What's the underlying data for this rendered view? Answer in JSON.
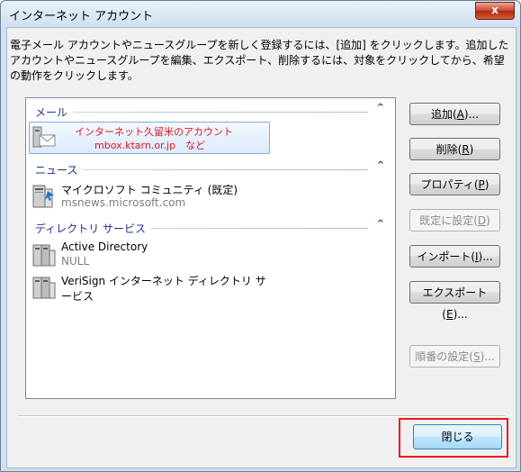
{
  "window": {
    "title": "インターネット アカウント",
    "close_glyph": "x"
  },
  "description": "電子メール アカウントやニュースグループを新しく登録するには、[追加] をクリックします。追加したアカウントやニュースグループを編集、エクスポート、削除するには、対象をクリックしてから、希望の動作をクリックします。",
  "groups": {
    "mail": {
      "label": "メール",
      "chevron": "^",
      "item_line1": "インターネット久留米のアカウント",
      "item_line2": "mbox.ktarn.or.jp　など"
    },
    "news": {
      "label": "ニュース",
      "chevron": "^",
      "item_name": "マイクロソフト コミュニティ (既定)",
      "item_sub": "msnews.microsoft.com"
    },
    "directory": {
      "label": "ディレクトリ サービス",
      "chevron": "^",
      "items": [
        {
          "name": "Active Directory",
          "sub": "NULL"
        },
        {
          "name": "VeriSign インターネット ディレクトリ サ",
          "name2": "ービス"
        }
      ]
    }
  },
  "buttons": {
    "add": {
      "pre": "追加(",
      "key": "A",
      "post": ")..."
    },
    "remove": {
      "pre": "削除(",
      "key": "R",
      "post": ")"
    },
    "properties": {
      "pre": "プロパティ(",
      "key": "P",
      "post": ")"
    },
    "set_default": {
      "pre": "既定に設定(",
      "key": "D",
      "post": ")"
    },
    "import": {
      "pre": "インポート(",
      "key": "I",
      "post": ")..."
    },
    "export": {
      "pre": "エクスポート(",
      "key": "E",
      "post": ")..."
    },
    "order": {
      "pre": "順番の設定(",
      "key": "S",
      "post": ")..."
    },
    "close": "閉じる"
  },
  "colors": {
    "highlight": "#e81c1c",
    "group_header": "#1e3287"
  }
}
